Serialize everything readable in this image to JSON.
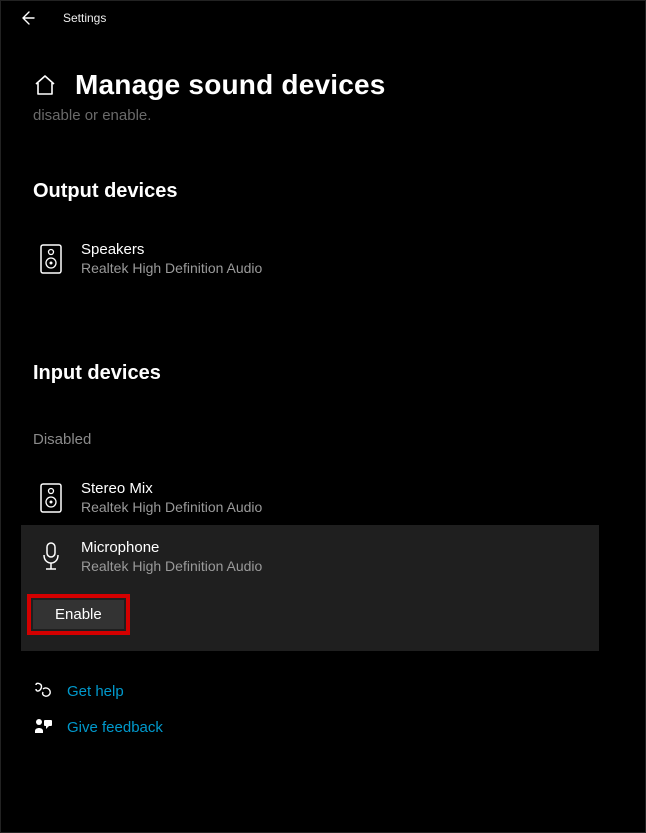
{
  "titlebar": {
    "label": "Settings"
  },
  "page": {
    "title": "Manage sound devices",
    "subtext": "disable or enable."
  },
  "output": {
    "section_title": "Output devices",
    "devices": [
      {
        "name": "Speakers",
        "sub": "Realtek High Definition Audio"
      }
    ]
  },
  "input": {
    "section_title": "Input devices",
    "status_label": "Disabled",
    "devices": [
      {
        "name": "Stereo Mix",
        "sub": "Realtek High Definition Audio"
      },
      {
        "name": "Microphone",
        "sub": "Realtek High Definition Audio"
      }
    ],
    "enable_button": "Enable"
  },
  "footer": {
    "help": "Get help",
    "feedback": "Give feedback"
  }
}
